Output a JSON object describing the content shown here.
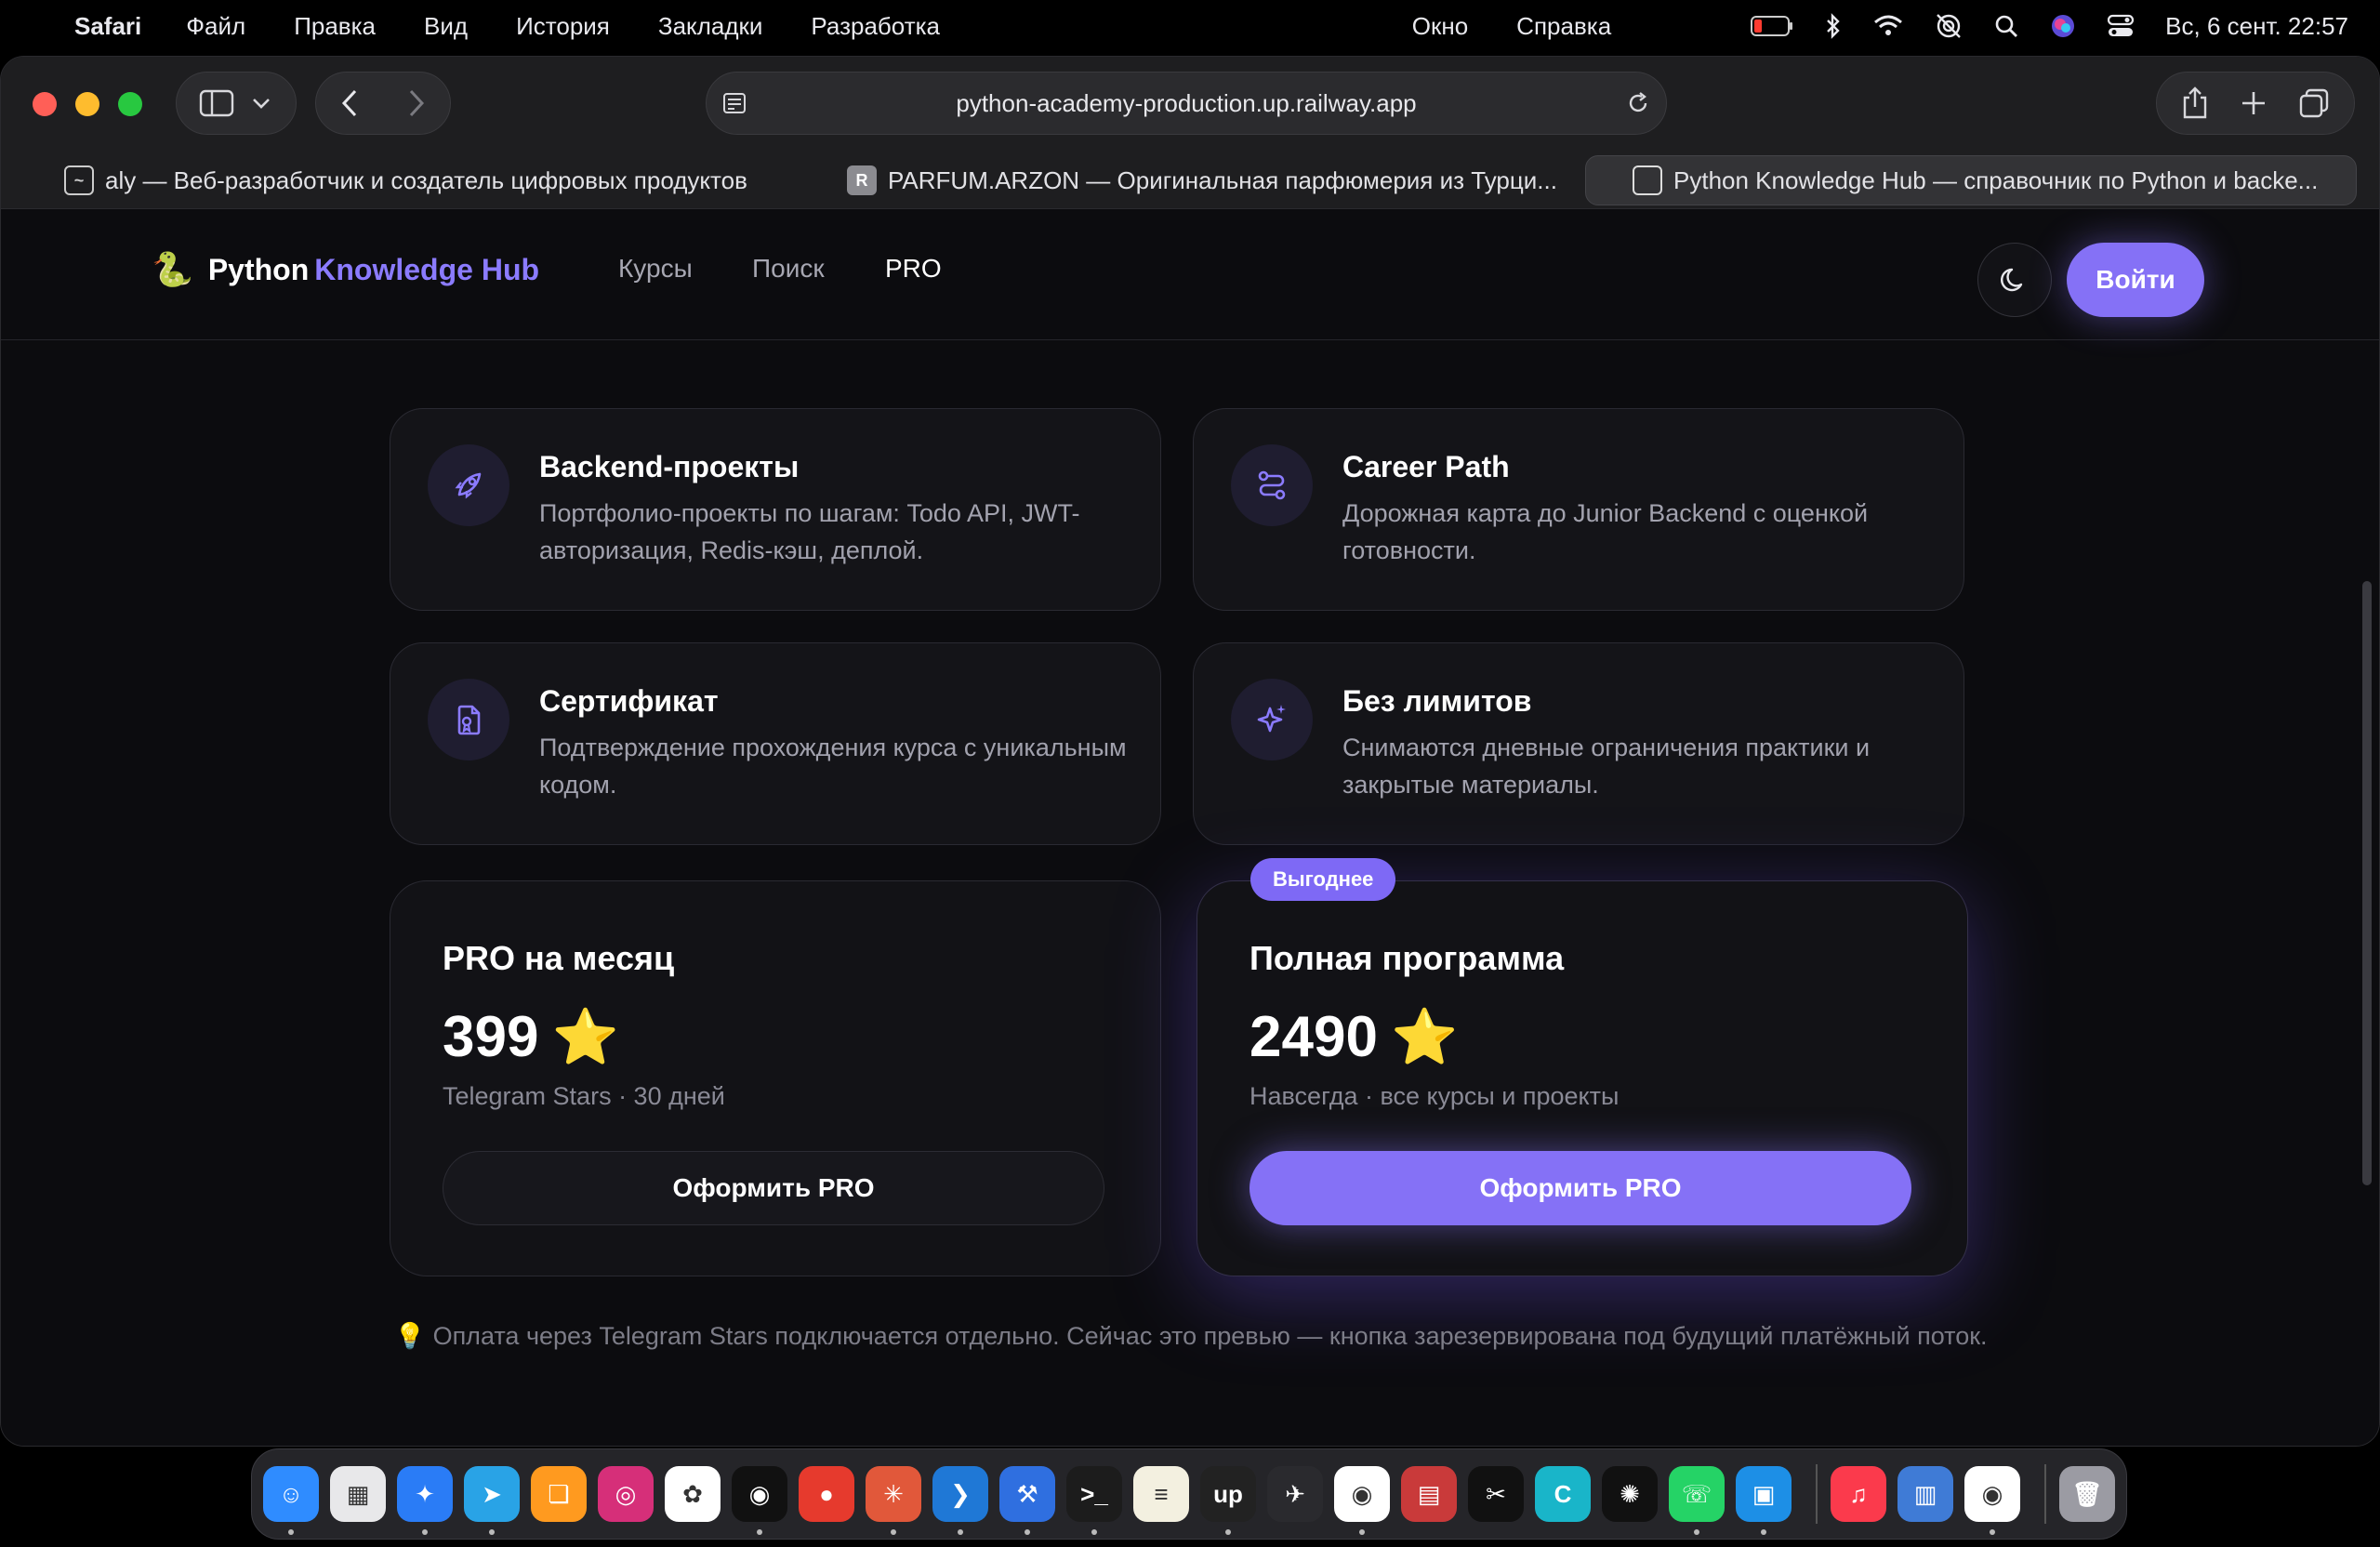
{
  "menubar": {
    "app": "Safari",
    "items": [
      "Файл",
      "Правка",
      "Вид",
      "История",
      "Закладки",
      "Разработка"
    ],
    "right_items": [
      "Окно",
      "Справка"
    ],
    "datetime": "Вс, 6 сент.  22:57"
  },
  "browser": {
    "url": "python-academy-production.up.railway.app",
    "tabs": [
      {
        "label": "aly — Веб-разработчик и создатель цифровых продуктов",
        "favicon": "~"
      },
      {
        "label": "PARFUM.ARZON — Оригинальная парфюмерия из Турци...",
        "favicon": "R"
      },
      {
        "label": "Python Knowledge Hub — справочник по Python и backe...",
        "favicon": ""
      }
    ]
  },
  "site": {
    "logo_emoji": "🐍",
    "logo_main": "Python",
    "logo_accent": "Knowledge Hub",
    "nav": [
      "Курсы",
      "Поиск",
      "PRO"
    ],
    "login": "Войти"
  },
  "features": [
    {
      "title": "Backend-проекты",
      "desc": "Портфолио-проекты по шагам: Todo API, JWT-авторизация, Redis-кэш, деплой.",
      "icon": "rocket-icon"
    },
    {
      "title": "Career Path",
      "desc": "Дорожная карта до Junior Backend с оценкой готовности.",
      "icon": "route-icon"
    },
    {
      "title": "Сертификат",
      "desc": "Подтверждение прохождения курса с уникальным кодом.",
      "icon": "certificate-icon"
    },
    {
      "title": "Без лимитов",
      "desc": "Снимаются дневные ограничения практики и закрытые материалы.",
      "icon": "sparkles-icon"
    }
  ],
  "plans": [
    {
      "title": "PRO на месяц",
      "price": "399",
      "star": "⭐",
      "sub": "Telegram Stars · 30 дней",
      "button": "Оформить PRO"
    },
    {
      "title": "Полная программа",
      "price": "2490",
      "star": "⭐",
      "sub": "Навсегда · все курсы и проекты",
      "button": "Оформить PRO",
      "badge": "Выгоднее"
    }
  ],
  "note": {
    "icon": "💡",
    "text": "Оплата через Telegram Stars подключается отдельно. Сейчас это превью — кнопка зарезервирована под будущий платёжный поток."
  },
  "colors": {
    "accent": "#8571f6",
    "bg": "#0c0c0f",
    "card": "#141418"
  },
  "dock": [
    {
      "name": "finder",
      "color": "#2f8cff",
      "glyph": "☺"
    },
    {
      "name": "launchpad",
      "color": "#e8e8ea",
      "glyph": "▦"
    },
    {
      "name": "safari",
      "color": "#2a7cf6",
      "glyph": "✦"
    },
    {
      "name": "telegram",
      "color": "#29a3e6",
      "glyph": "➤"
    },
    {
      "name": "books",
      "color": "#ff9a1f",
      "glyph": "❏"
    },
    {
      "name": "instagram",
      "color": "#d62f79",
      "glyph": "◎"
    },
    {
      "name": "photos",
      "color": "#ffffff",
      "glyph": "✿"
    },
    {
      "name": "spotify",
      "color": "#111111",
      "glyph": "◉"
    },
    {
      "name": "app-red",
      "color": "#e63a2d",
      "glyph": "●"
    },
    {
      "name": "claude",
      "color": "#e1583a",
      "glyph": "✳"
    },
    {
      "name": "vscode",
      "color": "#1f78d6",
      "glyph": "❯"
    },
    {
      "name": "xcode",
      "color": "#2f6fe0",
      "glyph": "⚒"
    },
    {
      "name": "terminal",
      "color": "#1c1c1c",
      "glyph": ">_"
    },
    {
      "name": "notes",
      "color": "#f3f0e0",
      "glyph": "≡"
    },
    {
      "name": "upwork",
      "color": "#222222",
      "glyph": "up"
    },
    {
      "name": "app-bird",
      "color": "#2a2a2e",
      "glyph": "✈"
    },
    {
      "name": "chrome",
      "color": "#ffffff",
      "glyph": "◉"
    },
    {
      "name": "app-archive",
      "color": "#c93a3a",
      "glyph": "▤"
    },
    {
      "name": "capcut",
      "color": "#111111",
      "glyph": "✂"
    },
    {
      "name": "canva",
      "color": "#19b5c9",
      "glyph": "C"
    },
    {
      "name": "chatgpt",
      "color": "#111111",
      "glyph": "✺"
    },
    {
      "name": "whatsapp",
      "color": "#25d366",
      "glyph": "☏"
    },
    {
      "name": "docker",
      "color": "#1d8fe6",
      "glyph": "▣"
    },
    {
      "name": "music",
      "color": "#fb3a4c",
      "glyph": "♫"
    },
    {
      "name": "app-storage",
      "color": "#3f7bd6",
      "glyph": "▥"
    },
    {
      "name": "chrome-2",
      "color": "#ffffff",
      "glyph": "◉"
    },
    {
      "name": "trash",
      "color": "#9b9ba3",
      "glyph": "🗑"
    }
  ]
}
